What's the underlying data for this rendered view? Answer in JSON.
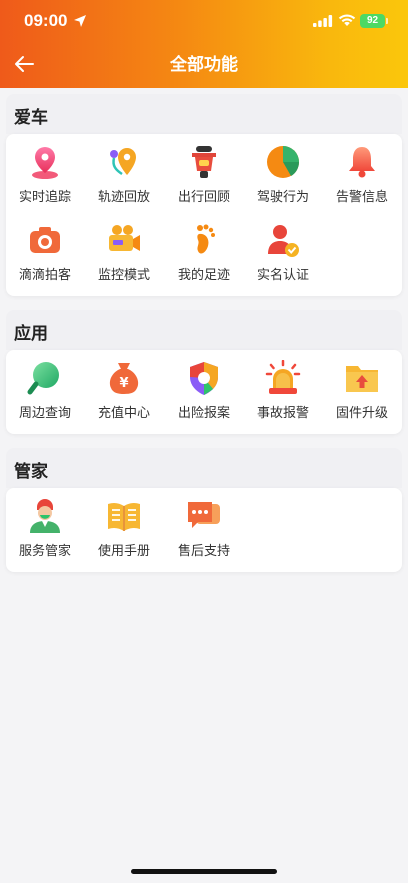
{
  "status_bar": {
    "time": "09:00",
    "battery": "92"
  },
  "nav": {
    "title": "全部功能",
    "back_icon": "arrow-left-icon"
  },
  "sections": [
    {
      "title": "爱车",
      "items": [
        {
          "label": "实时追踪",
          "icon": "location-pin-icon"
        },
        {
          "label": "轨迹回放",
          "icon": "route-icon"
        },
        {
          "label": "出行回顾",
          "icon": "scooter-icon"
        },
        {
          "label": "驾驶行为",
          "icon": "pie-chart-icon"
        },
        {
          "label": "告警信息",
          "icon": "bell-icon"
        },
        {
          "label": "滴滴拍客",
          "icon": "camera-icon"
        },
        {
          "label": "监控模式",
          "icon": "video-camera-icon"
        },
        {
          "label": "我的足迹",
          "icon": "footprint-icon"
        },
        {
          "label": "实名认证",
          "icon": "verified-user-icon"
        }
      ]
    },
    {
      "title": "应用",
      "items": [
        {
          "label": "周边查询",
          "icon": "magnifier-icon"
        },
        {
          "label": "充值中心",
          "icon": "money-bag-icon"
        },
        {
          "label": "出险报案",
          "icon": "shield-icon"
        },
        {
          "label": "事故报警",
          "icon": "alarm-light-icon"
        },
        {
          "label": "固件升级",
          "icon": "folder-upload-icon"
        }
      ]
    },
    {
      "title": "管家",
      "items": [
        {
          "label": "服务管家",
          "icon": "butler-icon"
        },
        {
          "label": "使用手册",
          "icon": "manual-book-icon"
        },
        {
          "label": "售后支持",
          "icon": "chat-support-icon"
        }
      ]
    }
  ]
}
